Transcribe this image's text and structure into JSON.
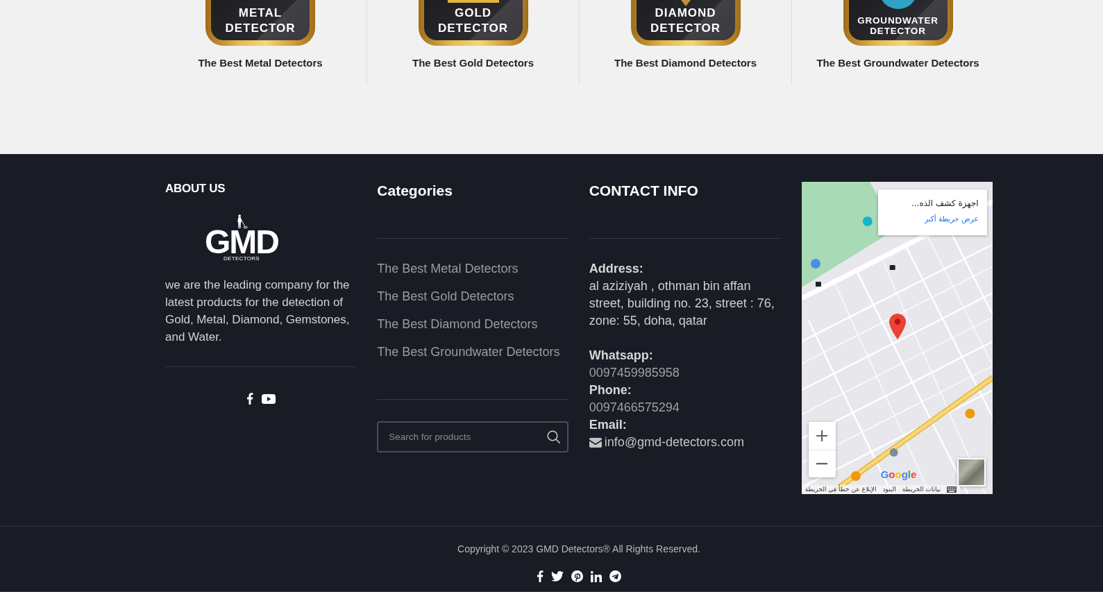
{
  "category_strip": {
    "items": [
      {
        "kind": "metal",
        "badge_text": [
          "METAL",
          "DETECTOR"
        ],
        "title": "The Best Metal Detectors"
      },
      {
        "kind": "gold",
        "badge_text": [
          "GOLD",
          "DETECTOR"
        ],
        "title": "The Best Gold Detectors"
      },
      {
        "kind": "diamond",
        "badge_text": [
          "DIAMOND",
          "DETECTOR"
        ],
        "title": "The Best Diamond Detectors"
      },
      {
        "kind": "groundwater",
        "badge_text": [
          "GROUNDWATER",
          "DETECTOR"
        ],
        "title": "The Best Groundwater Detectors"
      }
    ]
  },
  "footer": {
    "about": {
      "heading": "ABOUT US",
      "logo": {
        "wordmark": "GMD",
        "tagline": "DETECTORS"
      },
      "text": "we are the leading company for the latest products for the detection of Gold, Metal, Diamond, Gemstones, and Water.",
      "social": [
        {
          "kind": "facebook"
        },
        {
          "kind": "youtube"
        }
      ]
    },
    "categories": {
      "heading": "Categories",
      "links": [
        "The Best Metal Detectors",
        "The Best Gold Detectors",
        "The Best Diamond Detectors",
        "The Best Groundwater Detectors"
      ],
      "search": {
        "placeholder": "Search for products"
      }
    },
    "contact": {
      "heading": "CONTACT INFO",
      "items": [
        {
          "kind": "address",
          "label": "Address:",
          "value": "al aziziyah , othman bin affan street, building no. 23, street : 76, zone: 55, doha, qatar"
        },
        {
          "kind": "phone",
          "label": "Whatsapp:",
          "value": "0097459985958"
        },
        {
          "kind": "phone",
          "label": "Phone:",
          "value": "0097466575294"
        },
        {
          "kind": "email",
          "label": "Email:",
          "value": "info@gmd-detectors.com"
        }
      ]
    },
    "map": {
      "info_card": {
        "title": "اجهزة كشف الذه...",
        "link": "عرض خريطة أكبر"
      },
      "logo": "Google",
      "attribution": [
        "بيانات الخريطة",
        "البنود",
        "الإبلاغ عن خطأ في الخريطة"
      ]
    }
  },
  "bottom_bar": {
    "copyright": "Copyright © 2023 GMD Detectors® All Rights Reserved.",
    "social": [
      {
        "kind": "facebook"
      },
      {
        "kind": "twitter"
      },
      {
        "kind": "pinterest"
      },
      {
        "kind": "linkedin"
      },
      {
        "kind": "telegram"
      }
    ]
  }
}
